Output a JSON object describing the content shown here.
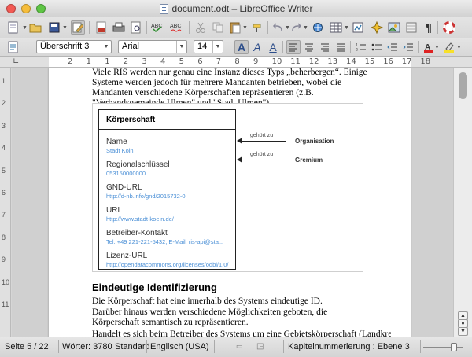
{
  "window": {
    "title": "document.odt – LibreOffice Writer"
  },
  "toolbar2": {
    "paragraph_style": "Überschrift 3",
    "font_name": "Arial",
    "font_size": "14"
  },
  "ruler": {
    "ticks": [
      "2",
      "1",
      "1",
      "2",
      "3",
      "4",
      "5",
      "6",
      "7",
      "8",
      "9",
      "10",
      "11",
      "12",
      "13",
      "14",
      "15",
      "16",
      "17",
      "18"
    ]
  },
  "vruler": {
    "ticks": [
      "1",
      "2",
      "3",
      "4",
      "5",
      "6",
      "7",
      "8",
      "9",
      "10",
      "11"
    ]
  },
  "document": {
    "intro": "Viele RIS werden nur genau eine Instanz dieses Typs „beherbergen“. Einige Systeme werden jedoch für mehrere Mandanten betrieben, wobei die Mandanten verschiedene Körperschaften repräsentieren (z.B. \"Verbandsgemeinde Ulmen\" und \"Stadt Ulmen\").",
    "figure": {
      "entity_title": "Körperschaft",
      "fields": [
        {
          "label": "Name",
          "value": "Stadt Köln"
        },
        {
          "label": "Regionalschlüssel",
          "value": "053150000000"
        },
        {
          "label": "GND-URL",
          "value": "http://d-nb.info/gnd/2015732-0"
        },
        {
          "label": "URL",
          "value": "http://www.stadt-koeln.de/"
        },
        {
          "label": "Betreiber-Kontakt",
          "value": "Tel. +49 221-221-5432, E-Mail: ris-api@sta..."
        },
        {
          "label": "Lizenz-URL",
          "value": "http://opendatacommons.org/licenses/odbl/1.0/"
        }
      ],
      "relations": [
        {
          "edge": "gehört zu",
          "target": "Organisation"
        },
        {
          "edge": "gehört zu",
          "target": "Gremium"
        }
      ]
    },
    "heading": "Eindeutige Identifizierung",
    "para1": "Die Körperschaft hat eine innerhalb des Systems eindeutige ID.",
    "para2": "Darüber hinaus werden verschiedene Möglichkeiten geboten, die Körperschaft semantisch zu repräsentieren.",
    "para3": "Handelt es sich beim Betreiber des Systems um eine Gebietskörperschaft (Landkreis, Kommune"
  },
  "statusbar": {
    "page": "Seite 5 / 22",
    "words": "Wörter: 3780",
    "page_style": "Standard",
    "language": "Englisch (USA)",
    "outline": "Kapitelnummerierung : Ebene 3"
  }
}
